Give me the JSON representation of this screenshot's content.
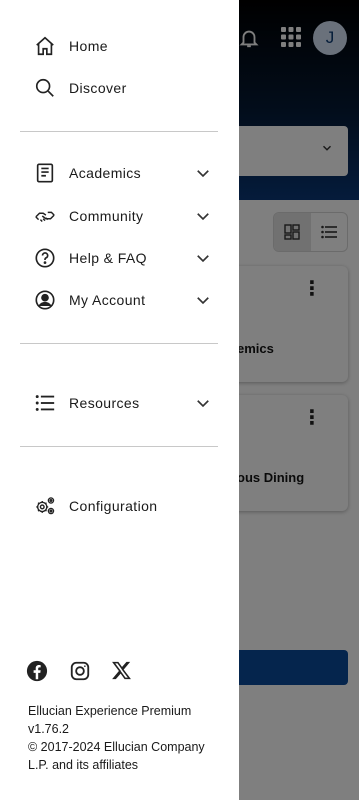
{
  "background": {
    "avatar_initial": "J",
    "cards": [
      {
        "title": "emics"
      },
      {
        "title": "ous Dining"
      }
    ]
  },
  "drawer": {
    "primary": [
      {
        "label": "Home",
        "icon": "home-icon"
      },
      {
        "label": "Discover",
        "icon": "search-icon"
      }
    ],
    "sections": [
      {
        "label": "Academics",
        "icon": "book-icon"
      },
      {
        "label": "Community",
        "icon": "handshake-icon"
      },
      {
        "label": "Help & FAQ",
        "icon": "help-icon"
      },
      {
        "label": "My Account",
        "icon": "account-icon"
      }
    ],
    "resources": {
      "label": "Resources",
      "icon": "list-icon"
    },
    "configuration": {
      "label": "Configuration",
      "icon": "gears-icon"
    },
    "social": [
      "facebook-icon",
      "instagram-icon",
      "x-icon"
    ],
    "footer": {
      "product": "Ellucian Experience Premium",
      "version": "v1.76.2",
      "copyright_line1": "© 2017-2024 Ellucian Company",
      "copyright_line2": "L.P. and its affiliates"
    }
  },
  "colors": {
    "header_dark": "#000000",
    "header_blue": "#0a3777",
    "avatar_bg": "#d4e3f7",
    "button_blue": "#0a4a9b"
  }
}
